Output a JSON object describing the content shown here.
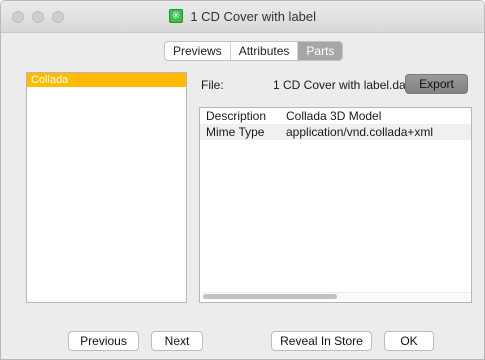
{
  "window": {
    "title": "1 CD Cover with label",
    "app_icon": "asterisk-app-icon"
  },
  "tabs": [
    {
      "label": "Previews",
      "active": false
    },
    {
      "label": "Attributes",
      "active": false
    },
    {
      "label": "Parts",
      "active": true
    }
  ],
  "parts_list": {
    "items": [
      {
        "label": "Collada",
        "selected": true
      }
    ]
  },
  "file": {
    "label": "File:",
    "name": "1 CD Cover with label.dae",
    "export_label": "Export"
  },
  "properties": [
    {
      "key": "Description",
      "value": "Collada 3D Model"
    },
    {
      "key": "Mime Type",
      "value": "application/vnd.collada+xml"
    }
  ],
  "footer": {
    "previous_label": "Previous",
    "next_label": "Next",
    "reveal_label": "Reveal In Store",
    "ok_label": "OK"
  },
  "colors": {
    "selection": "#ffbb00",
    "active_tab": "#a6a6a6",
    "app_icon": "#3cbf4a"
  }
}
